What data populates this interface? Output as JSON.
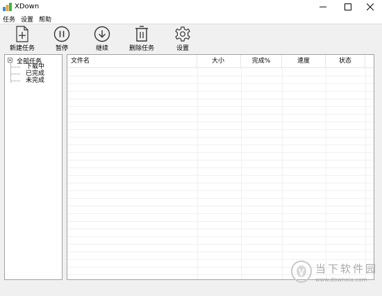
{
  "window": {
    "title": "XDown"
  },
  "menu": [
    "任务",
    "设置",
    "帮助"
  ],
  "toolbar": [
    {
      "label": "新建任务",
      "icon": "new-file-icon"
    },
    {
      "label": "暂停",
      "icon": "pause-icon"
    },
    {
      "label": "继续",
      "icon": "download-icon"
    },
    {
      "label": "删除任务",
      "icon": "trash-icon"
    },
    {
      "label": "设置",
      "icon": "gear-icon"
    }
  ],
  "tree": {
    "root": "全部任务",
    "children": [
      "下载中",
      "已完成",
      "未完成"
    ]
  },
  "table": {
    "columns": [
      "文件名",
      "大小",
      "完成%",
      "速度",
      "状态"
    ],
    "rows": []
  },
  "watermark": {
    "name": "当下软件园",
    "url": "www.downxia.com"
  }
}
